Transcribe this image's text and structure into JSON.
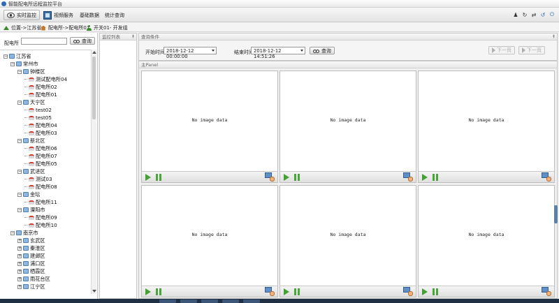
{
  "app": {
    "title": "智能配电所远程监控平台"
  },
  "menu": [
    {
      "label": "实时监控",
      "icon": "eye-icon",
      "active": true
    },
    {
      "label": "视频服务",
      "icon": "film-icon"
    },
    {
      "label": "基础数据"
    },
    {
      "label": "统计查询"
    }
  ],
  "toolbar_icons": [
    "user-icon",
    "refresh-icon",
    "swap-icon",
    "reload-icon",
    "power-icon"
  ],
  "breadcrumb": {
    "location": "位置->江苏省",
    "station": "配电所->配电所01",
    "switch": "开关01- 开发组"
  },
  "left": {
    "search_label": "配电所",
    "search_value": "",
    "search_button": "查询",
    "tree": [
      {
        "label": "江苏省",
        "level": 0,
        "type": "folder",
        "expanded": true
      },
      {
        "label": "常州市",
        "level": 1,
        "type": "folder",
        "expanded": true
      },
      {
        "label": "钟楼区",
        "level": 2,
        "type": "folder",
        "expanded": true
      },
      {
        "label": "测试配电所04",
        "level": 3,
        "type": "leaf"
      },
      {
        "label": "配电所02",
        "level": 3,
        "type": "leaf"
      },
      {
        "label": "配电所01",
        "level": 3,
        "type": "leaf"
      },
      {
        "label": "天宁区",
        "level": 2,
        "type": "folder",
        "expanded": true
      },
      {
        "label": "test02",
        "level": 3,
        "type": "leaf"
      },
      {
        "label": "test05",
        "level": 3,
        "type": "leaf"
      },
      {
        "label": "配电所04",
        "level": 3,
        "type": "leaf"
      },
      {
        "label": "配电所03",
        "level": 3,
        "type": "leaf"
      },
      {
        "label": "新北区",
        "level": 2,
        "type": "folder",
        "expanded": true
      },
      {
        "label": "配电所06",
        "level": 3,
        "type": "leaf"
      },
      {
        "label": "配电所07",
        "level": 3,
        "type": "leaf"
      },
      {
        "label": "配电所05",
        "level": 3,
        "type": "leaf"
      },
      {
        "label": "武进区",
        "level": 2,
        "type": "folder",
        "expanded": true
      },
      {
        "label": "测试03",
        "level": 3,
        "type": "leaf"
      },
      {
        "label": "配电所08",
        "level": 3,
        "type": "leaf"
      },
      {
        "label": "金坛",
        "level": 2,
        "type": "folder",
        "expanded": true
      },
      {
        "label": "配电所11",
        "level": 3,
        "type": "leaf"
      },
      {
        "label": "溧阳市",
        "level": 2,
        "type": "folder",
        "expanded": true
      },
      {
        "label": "配电所09",
        "level": 3,
        "type": "leaf"
      },
      {
        "label": "配电所10",
        "level": 3,
        "type": "leaf"
      },
      {
        "label": "南京市",
        "level": 1,
        "type": "folder",
        "expanded": true
      },
      {
        "label": "玄武区",
        "level": 2,
        "type": "folder"
      },
      {
        "label": "秦淮区",
        "level": 2,
        "type": "folder"
      },
      {
        "label": "建邺区",
        "level": 2,
        "type": "folder"
      },
      {
        "label": "浦口区",
        "level": 2,
        "type": "folder"
      },
      {
        "label": "栖霞区",
        "level": 2,
        "type": "folder"
      },
      {
        "label": "雨花台区",
        "level": 2,
        "type": "folder"
      },
      {
        "label": "江宁区",
        "level": 2,
        "type": "folder"
      }
    ]
  },
  "middle": {
    "title": "监控列表"
  },
  "query": {
    "title": "查询条件",
    "start_label": "开始时间",
    "start_value": "2018-12-12 00:00:00",
    "end_label": "结束时间",
    "end_value": "2018-12-12 14:51:26",
    "button": "查询",
    "prev": "下一页",
    "next": "下一页"
  },
  "main": {
    "title": "主Panel",
    "cells": [
      {
        "text": "No image data"
      },
      {
        "text": "No image data"
      },
      {
        "text": "No image data"
      },
      {
        "text": "No image data"
      },
      {
        "text": "No image data"
      },
      {
        "text": "No image data"
      }
    ]
  }
}
